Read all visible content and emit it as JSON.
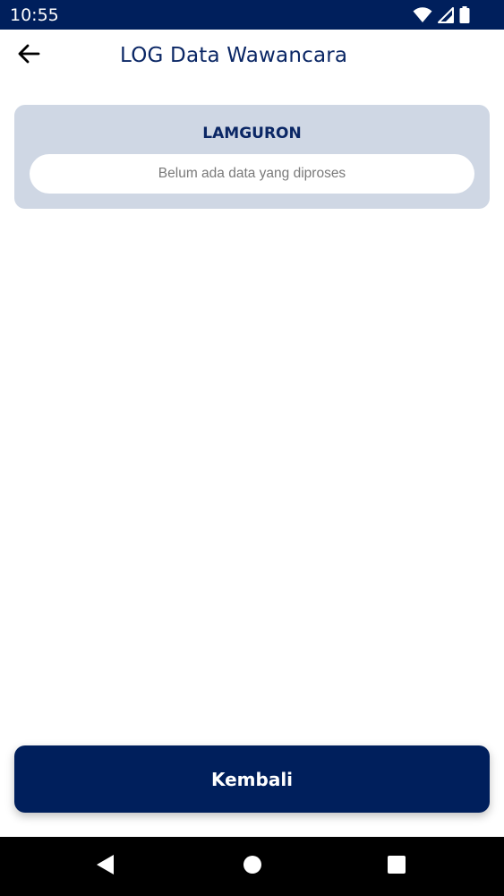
{
  "status_bar": {
    "time": "10:55",
    "background": "#001f5c",
    "icons": [
      "wifi-icon",
      "cell-signal-icon",
      "battery-icon"
    ]
  },
  "app_bar": {
    "title": "LOG Data Wawancara",
    "back_icon": "arrow-left-icon"
  },
  "card": {
    "title": "LAMGURON",
    "message": "Belum ada data yang diproses",
    "background": "#cfd7e4"
  },
  "footer": {
    "button_label": "Kembali",
    "button_color": "#001f5c"
  },
  "nav_bar": {
    "icons": [
      "back-triangle-icon",
      "home-circle-icon",
      "recents-square-icon"
    ]
  }
}
